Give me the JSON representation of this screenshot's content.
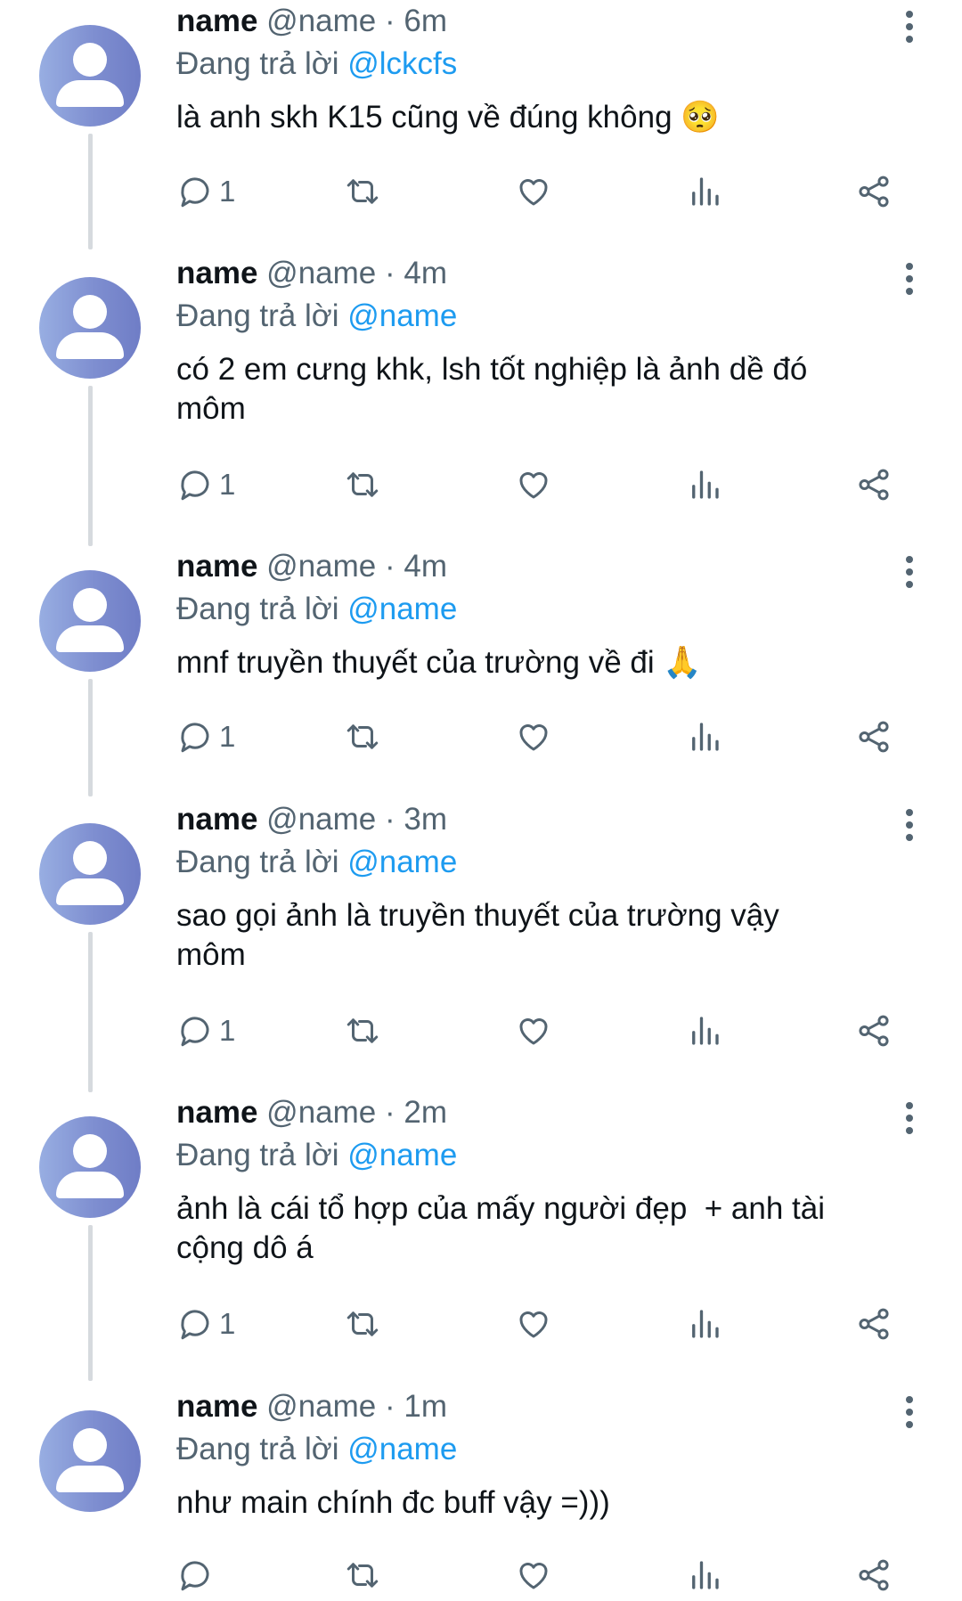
{
  "replying_label": "Đang trả lời",
  "tweets": [
    {
      "display_name": "name",
      "handle": "@name",
      "separator": "·",
      "time": "6m",
      "reply_to": "@lckcfs",
      "text": "là anh skh K15 cũng về đúng không 🥺",
      "reply_count": "1"
    },
    {
      "display_name": "name",
      "handle": "@name",
      "separator": "·",
      "time": "4m",
      "reply_to": "@name",
      "text": "có 2 em cưng khk, lsh tốt nghiệp là ảnh dề đó\nmôm",
      "reply_count": "1"
    },
    {
      "display_name": "name",
      "handle": "@name",
      "separator": "·",
      "time": "4m",
      "reply_to": "@name",
      "text": "mnf truyền thuyết của trường về đi 🙏",
      "reply_count": "1"
    },
    {
      "display_name": "name",
      "handle": "@name",
      "separator": "·",
      "time": "3m",
      "reply_to": "@name",
      "text": "sao gọi ảnh là truyền thuyết của trường vậy\nmôm",
      "reply_count": "1"
    },
    {
      "display_name": "name",
      "handle": "@name",
      "separator": "·",
      "time": "2m",
      "reply_to": "@name",
      "text": "ảnh là cái tổ hợp của mấy người đẹp  + anh tài\ncộng dô á",
      "reply_count": "1"
    },
    {
      "display_name": "name",
      "handle": "@name",
      "separator": "·",
      "time": "1m",
      "reply_to": "@name",
      "text": "như main chính đc buff vậy =)))",
      "reply_count": ""
    }
  ],
  "icons": {
    "reply": "reply-icon",
    "retweet": "retweet-icon",
    "like": "heart-icon",
    "views": "views-icon",
    "share": "share-icon",
    "more": "more-vertical-icon"
  },
  "colors": {
    "text": "#0f1419",
    "secondary": "#536471",
    "mention": "#1d9bf0",
    "thread_line": "#d6dade"
  }
}
